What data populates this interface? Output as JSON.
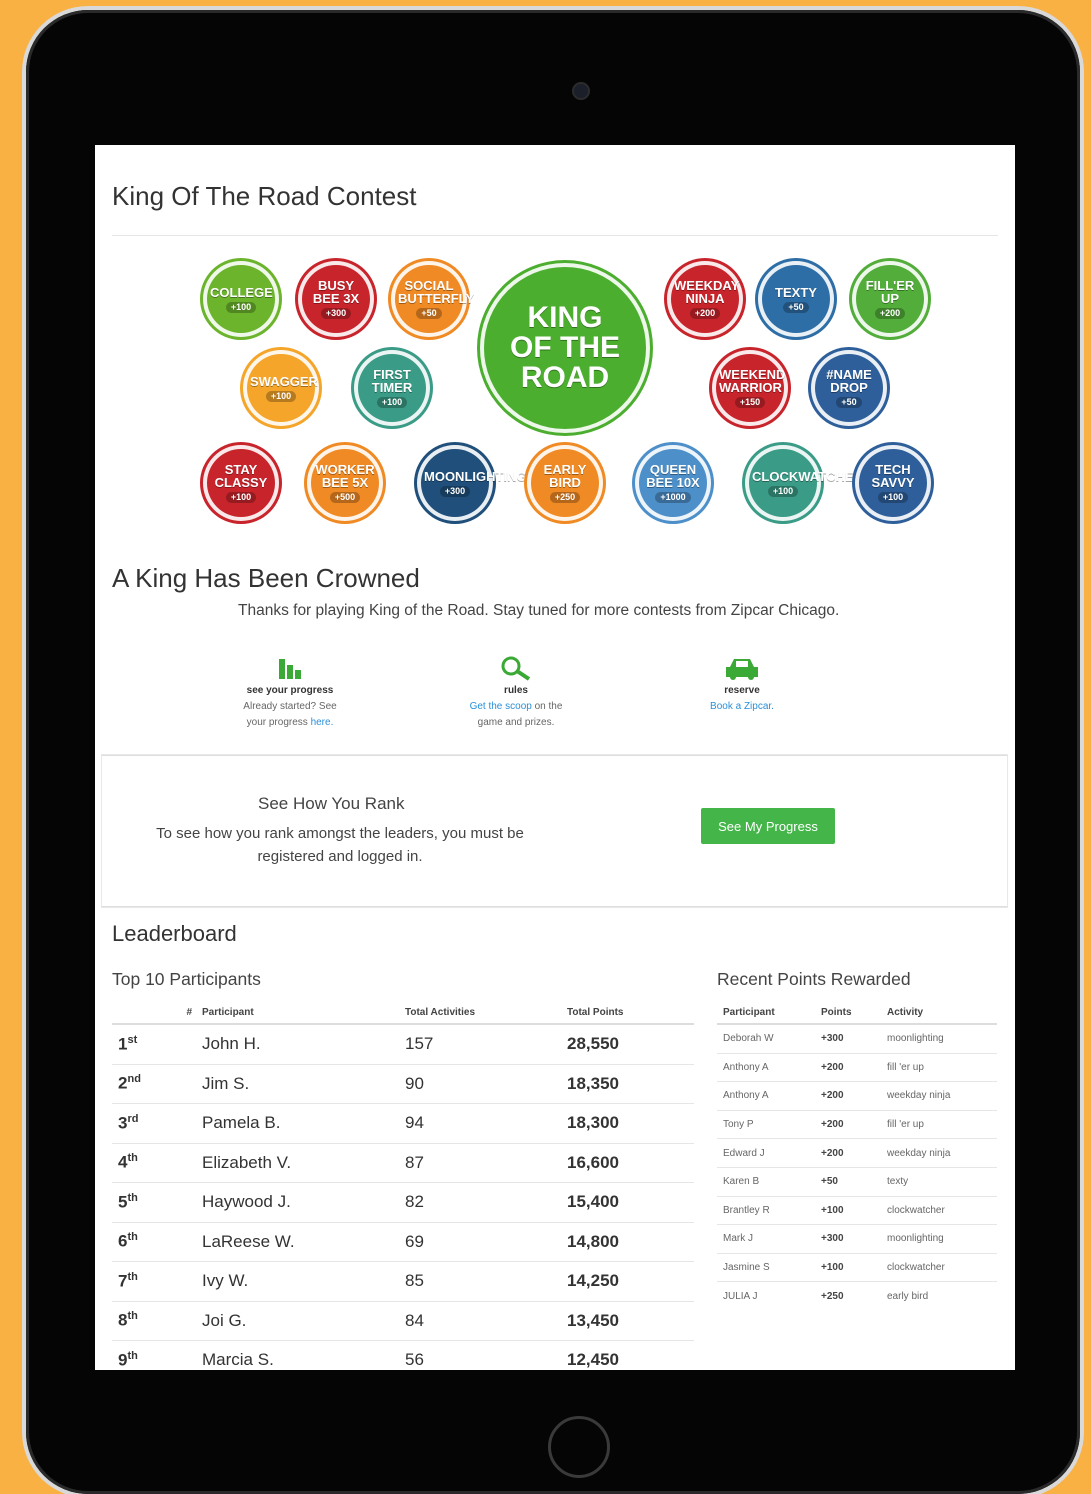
{
  "page": {
    "title": "King Of The Road Contest",
    "crowned_heading": "A King Has Been Crowned",
    "thanks": "Thanks for playing King of the Road. Stay tuned for more contests from Zipcar Chicago."
  },
  "badges": [
    {
      "label": "COLLEGE",
      "points": "+100",
      "color": "#6bb42c"
    },
    {
      "label": "BUSY BEE 3X",
      "points": "+300",
      "color": "#c8242b"
    },
    {
      "label": "SOCIAL BUTTERFLY",
      "points": "+50",
      "color": "#f08a24"
    },
    {
      "label": "KING OF THE ROAD",
      "points": "",
      "color": "#4cae2f"
    },
    {
      "label": "WEEKDAY NINJA",
      "points": "+200",
      "color": "#c8242b"
    },
    {
      "label": "TEXTY",
      "points": "+50",
      "color": "#2e6ea6"
    },
    {
      "label": "FILL'ER UP",
      "points": "+200",
      "color": "#52ad3a"
    },
    {
      "label": "SWAGGER",
      "points": "+100",
      "color": "#f4a52a"
    },
    {
      "label": "FIRST TIMER",
      "points": "+100",
      "color": "#3a9b86"
    },
    {
      "label": "WEEKEND WARRIOR",
      "points": "+150",
      "color": "#c8242b"
    },
    {
      "label": "#NAME DROP",
      "points": "+50",
      "color": "#2e5f9a"
    },
    {
      "label": "STAY CLASSY",
      "points": "+100",
      "color": "#c8242b"
    },
    {
      "label": "WORKER BEE 5X",
      "points": "+500",
      "color": "#f08a24"
    },
    {
      "label": "MOONLIGHTING",
      "points": "+300",
      "color": "#1f4f7a"
    },
    {
      "label": "EARLY BIRD",
      "points": "+250",
      "color": "#f08a24"
    },
    {
      "label": "QUEEN BEE 10X",
      "points": "+1000",
      "color": "#4d8fc9"
    },
    {
      "label": "CLOCKWATCHER",
      "points": "+100",
      "color": "#3a9b86"
    },
    {
      "label": "TECH SAVVY",
      "points": "+100",
      "color": "#2e5f9a"
    }
  ],
  "features": [
    {
      "icon": "bar-chart-icon",
      "title": "see your progress",
      "text1": "Already started? See",
      "text2": "your progress ",
      "link": "here."
    },
    {
      "icon": "magnifier-icon",
      "title": "rules",
      "link": "Get the scoop",
      "text1": " on the",
      "text2": "game and prizes."
    },
    {
      "icon": "car-icon",
      "title": "reserve",
      "link": "Book a Zipcar."
    }
  ],
  "rank": {
    "title": "See How You Rank",
    "text": "To see how you rank amongst the leaders, you must be registered and logged in.",
    "button": "See My Progress"
  },
  "leaderboard": {
    "title": "Leaderboard",
    "subtitle": "Top 10 Participants",
    "headers": [
      "#",
      "Participant",
      "Total Activities",
      "Total Points"
    ],
    "rows": [
      {
        "rank": "1",
        "suffix": "st",
        "name": "John H.",
        "activities": "157",
        "points": "28,550"
      },
      {
        "rank": "2",
        "suffix": "nd",
        "name": "Jim S.",
        "activities": "90",
        "points": "18,350"
      },
      {
        "rank": "3",
        "suffix": "rd",
        "name": "Pamela B.",
        "activities": "94",
        "points": "18,300"
      },
      {
        "rank": "4",
        "suffix": "th",
        "name": "Elizabeth V.",
        "activities": "87",
        "points": "16,600"
      },
      {
        "rank": "5",
        "suffix": "th",
        "name": "Haywood J.",
        "activities": "82",
        "points": "15,400"
      },
      {
        "rank": "6",
        "suffix": "th",
        "name": "LaReese W.",
        "activities": "69",
        "points": "14,800"
      },
      {
        "rank": "7",
        "suffix": "th",
        "name": "Ivy W.",
        "activities": "85",
        "points": "14,250"
      },
      {
        "rank": "8",
        "suffix": "th",
        "name": "Joi G.",
        "activities": "84",
        "points": "13,450"
      },
      {
        "rank": "9",
        "suffix": "th",
        "name": "Marcia S.",
        "activities": "56",
        "points": "12,450"
      }
    ]
  },
  "recent": {
    "title": "Recent Points Rewarded",
    "headers": [
      "Participant",
      "Points",
      "Activity"
    ],
    "rows": [
      {
        "name": "Deborah W",
        "points": "+300",
        "activity": "moonlighting"
      },
      {
        "name": "Anthony A",
        "points": "+200",
        "activity": "fill 'er up"
      },
      {
        "name": "Anthony A",
        "points": "+200",
        "activity": "weekday ninja"
      },
      {
        "name": "Tony P",
        "points": "+200",
        "activity": "fill 'er up"
      },
      {
        "name": "Edward J",
        "points": "+200",
        "activity": "weekday ninja"
      },
      {
        "name": "Karen B",
        "points": "+50",
        "activity": "texty"
      },
      {
        "name": "Brantley R",
        "points": "+100",
        "activity": "clockwatcher"
      },
      {
        "name": "Mark J",
        "points": "+300",
        "activity": "moonlighting"
      },
      {
        "name": "Jasmine S",
        "points": "+100",
        "activity": "clockwatcher"
      },
      {
        "name": "JULIA J",
        "points": "+250",
        "activity": "early bird"
      }
    ]
  }
}
